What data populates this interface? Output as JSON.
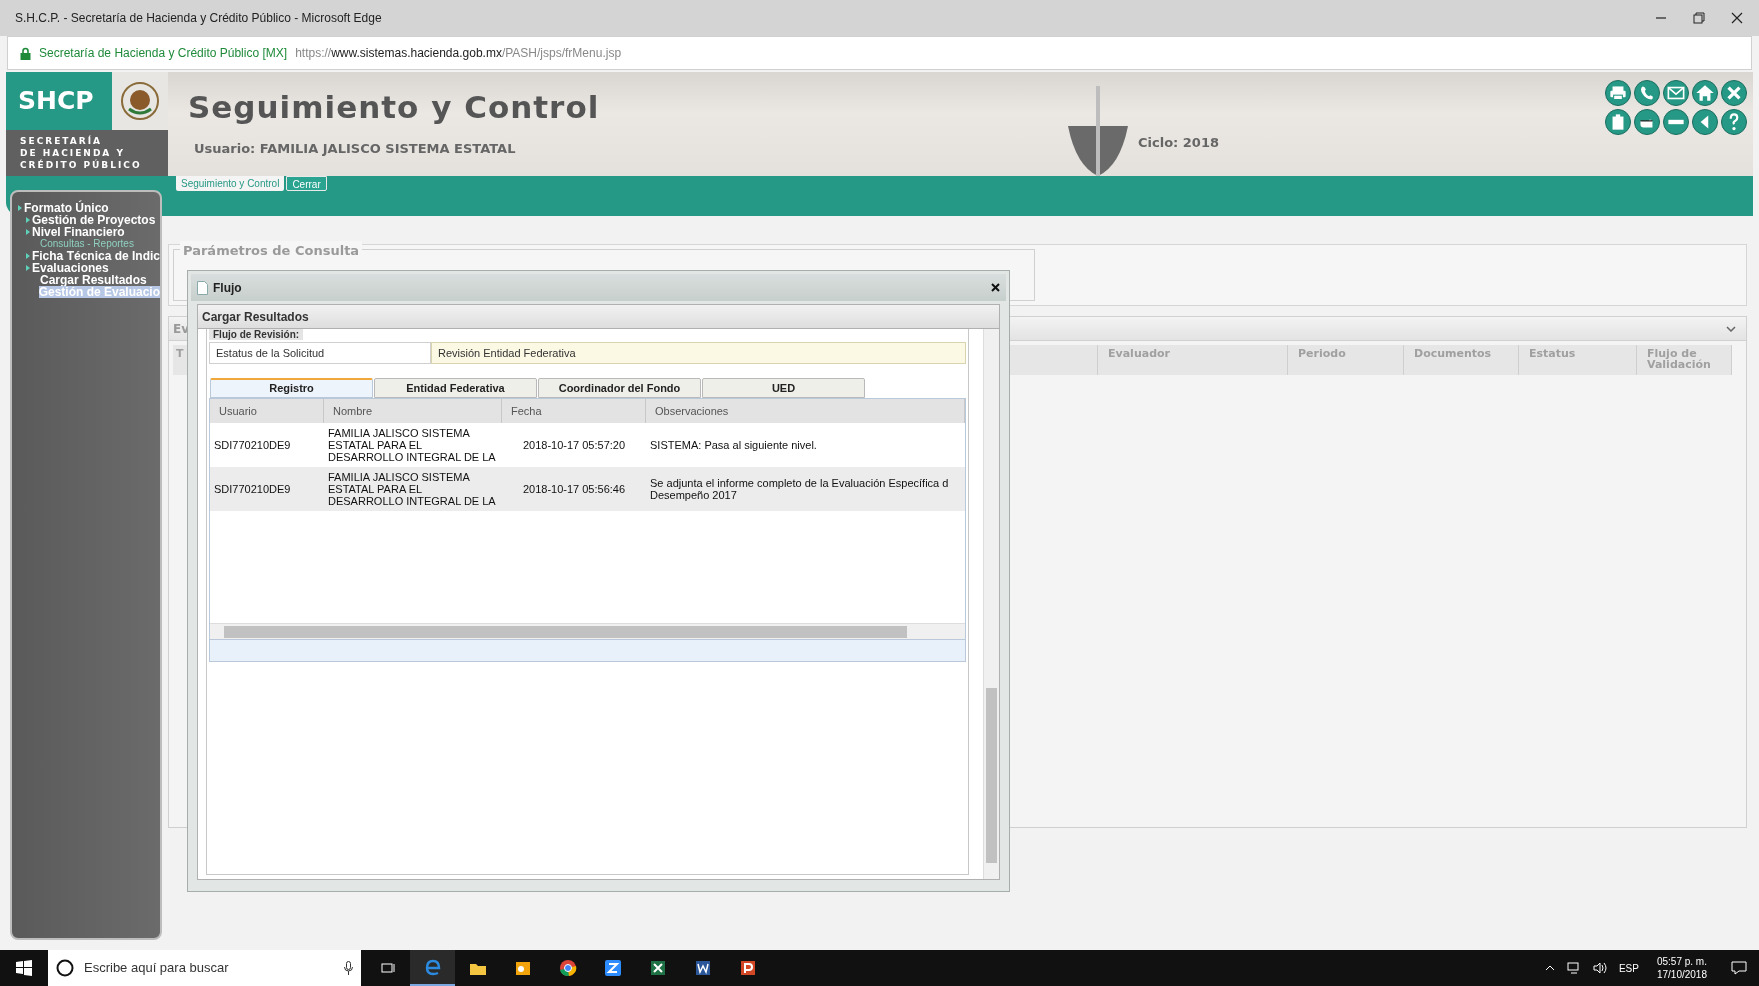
{
  "browser": {
    "title": "S.H.C.P. - Secretaría de Hacienda y Crédito Público - Microsoft Edge",
    "site_identity": "Secretaría de Hacienda y Crédito Público [MX]",
    "url_scheme": "https://",
    "url_host": "www.sistemas.hacienda.gob.mx",
    "url_path": "/PASH/jsps/frMenu.jsp"
  },
  "header": {
    "logo": "SHCP",
    "agency_lines": [
      "SECRETARÍA",
      "DE HACIENDA Y",
      "CRÉDITO PÚBLICO"
    ],
    "title": "Seguimiento y Control",
    "user": "Usuario: FAMILIA JALISCO SISTEMA ESTATAL",
    "cycle": "Ciclo: 2018",
    "tabs": [
      {
        "label": "Seguimiento y Control",
        "selected": true
      },
      {
        "label": "Cerrar",
        "selected": false
      }
    ]
  },
  "sidebar": {
    "items": [
      {
        "label": "Formato Único",
        "kind": "folder",
        "selected": false,
        "children": [
          {
            "label": "Gestión de Proyectos",
            "kind": "folder",
            "selected": false
          },
          {
            "label": "Nivel Financiero",
            "kind": "folder",
            "selected": false,
            "children": [
              {
                "label": "Consultas - Reportes",
                "kind": "link",
                "selected": false
              }
            ]
          },
          {
            "label": "Ficha Técnica de Indic",
            "kind": "folder",
            "selected": false
          },
          {
            "label": "Evaluaciones",
            "kind": "folder",
            "selected": false,
            "children": [
              {
                "label": "Cargar Resultados",
                "kind": "entry",
                "selected": false
              },
              {
                "label": "Gestión de Evaluacio",
                "kind": "entry",
                "selected": true
              }
            ]
          }
        ]
      }
    ]
  },
  "parameters": {
    "legend": "Parámetros de Consulta"
  },
  "results_panel": {
    "title": "Ev",
    "columns": [
      "T",
      "Evaluador",
      "Periodo",
      "Documentos",
      "Estatus",
      "Flujo de Validación"
    ]
  },
  "dialog": {
    "title": "Flujo",
    "panel_title": "Cargar Resultados",
    "section_title": "Flujo de Revisión:",
    "status_label": "Estatus de la Solicitud",
    "status_value": "Revisión Entidad Federativa",
    "tabs": [
      {
        "label": "Registro",
        "selected": true
      },
      {
        "label": "Entidad Federativa",
        "selected": false
      },
      {
        "label": "Coordinador del Fondo",
        "selected": false
      },
      {
        "label": "UED",
        "selected": false
      }
    ],
    "table": {
      "columns": [
        "Usuario",
        "Nombre",
        "Fecha",
        "Observaciones"
      ],
      "rows": [
        [
          "SDI770210DE9",
          "FAMILIA JALISCO SISTEMA ESTATAL PARA EL DESARROLLO INTEGRAL DE LA",
          "2018-10-17 05:57:20",
          "SISTEMA: Pasa al siguiente nivel."
        ],
        [
          "SDI770210DE9",
          "FAMILIA JALISCO SISTEMA ESTATAL PARA EL DESARROLLO INTEGRAL DE LA",
          "2018-10-17 05:56:46",
          "Se adjunta el informe completo de la Evaluación Específica d Desempeño 2017"
        ]
      ]
    }
  },
  "taskbar": {
    "search_placeholder": "Escribe aquí para buscar",
    "language": "ESP",
    "time": "05:57 p. m.",
    "date": "17/10/2018"
  }
}
